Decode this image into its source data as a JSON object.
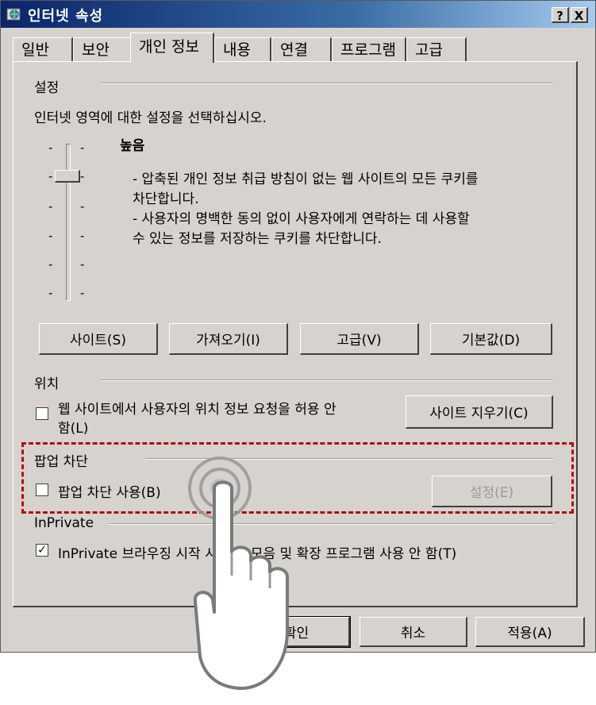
{
  "window": {
    "title": "인터넷 속성",
    "help_button": "?",
    "close_button": "X"
  },
  "tabs": [
    {
      "label": "일반",
      "active": false
    },
    {
      "label": "보안",
      "active": false
    },
    {
      "label": "개인 정보",
      "active": true
    },
    {
      "label": "내용",
      "active": false
    },
    {
      "label": "연결",
      "active": false
    },
    {
      "label": "프로그램",
      "active": false
    },
    {
      "label": "고급",
      "active": false
    }
  ],
  "settings": {
    "heading": "설정",
    "description": "인터넷 영역에 대한 설정을 선택하십시오.",
    "level_title": "높음",
    "level_desc_1": "- 압축된 개인 정보 취급 방침이 없는 웹 사이트의 모든 쿠키를",
    "level_desc_2": "차단합니다.",
    "level_desc_3": "- 사용자의 명백한 동의 없이 사용자에게 연락하는 데 사용할",
    "level_desc_4": "수 있는 정보를 저장하는 쿠키를 차단합니다.",
    "buttons": {
      "sites": "사이트(S)",
      "import": "가져오기(I)",
      "advanced": "고급(V)",
      "default": "기본값(D)"
    }
  },
  "location": {
    "heading": "위치",
    "checkbox_line1": "웹 사이트에서 사용자의 위치 정보 요청을 허용 안",
    "checkbox_line2": "함(L)",
    "checked": false,
    "clear_sites_button": "사이트 지우기(C)"
  },
  "popup": {
    "heading": "팝업 차단",
    "checkbox_label": "팝업 차단 사용(B)",
    "checked": false,
    "settings_button": "설정(E)"
  },
  "inprivate": {
    "heading": "InPrivate",
    "checkbox_label": "InPrivate 브라우징 시작 시 도구 모음 및 확장 프로그램 사용 안 함(T)",
    "checked": true
  },
  "footer": {
    "ok": "확인",
    "cancel": "취소",
    "apply": "적용(A)"
  },
  "colors": {
    "dialog_bg": "#d6d3ce",
    "highlight": "#b10d0d",
    "title_gradient_start": "#0a246a"
  }
}
